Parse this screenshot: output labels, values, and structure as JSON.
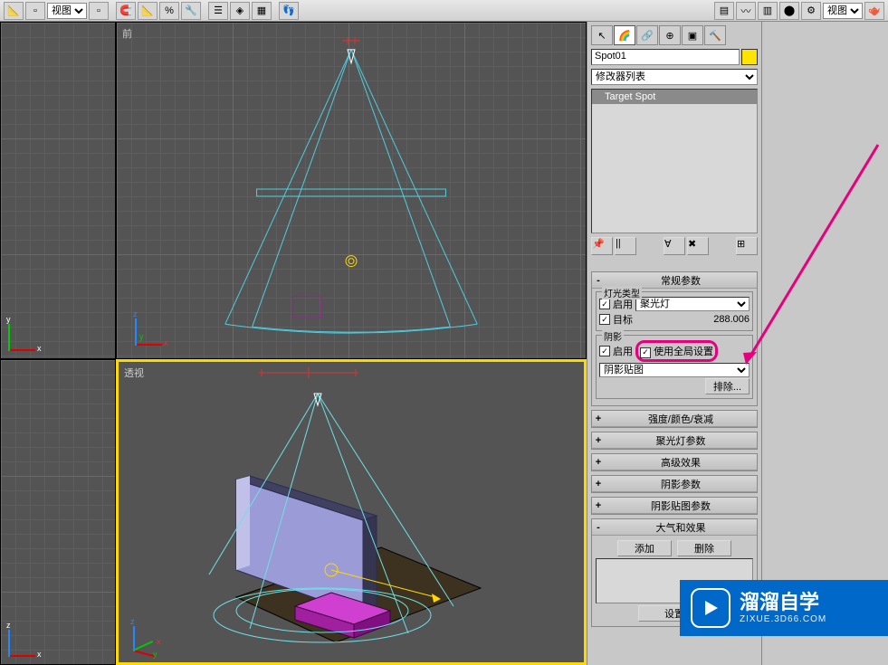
{
  "toolbar": {
    "view_dropdown_left": "视图",
    "view_dropdown_right": "视图"
  },
  "viewports": {
    "top_right_label": "前",
    "bot_right_label": "透视"
  },
  "panel": {
    "object_name": "Spot01",
    "modifier_list_label": "修改器列表",
    "stack_item": "Target Spot"
  },
  "rollouts": {
    "general": {
      "title": "常规参数",
      "light_type_group": "灯光类型",
      "enable": "启用",
      "light_type_value": "聚光灯",
      "target": "目标",
      "target_distance": "288.006",
      "shadow_group": "阴影",
      "shadow_enable": "启用",
      "use_global": "使用全局设置",
      "shadow_map": "阴影贴图",
      "exclude_btn": "排除..."
    },
    "intensity": "强度/颜色/衰减",
    "spotlight": "聚光灯参数",
    "advanced": "高级效果",
    "shadow_params": "阴影参数",
    "shadow_map_params": "阴影贴图参数",
    "atmo": {
      "title": "大气和效果",
      "add": "添加",
      "delete": "删除",
      "setup": "设置"
    }
  },
  "watermark": {
    "main": "溜溜自学",
    "sub": "ZIXUE.3D66.COM"
  }
}
